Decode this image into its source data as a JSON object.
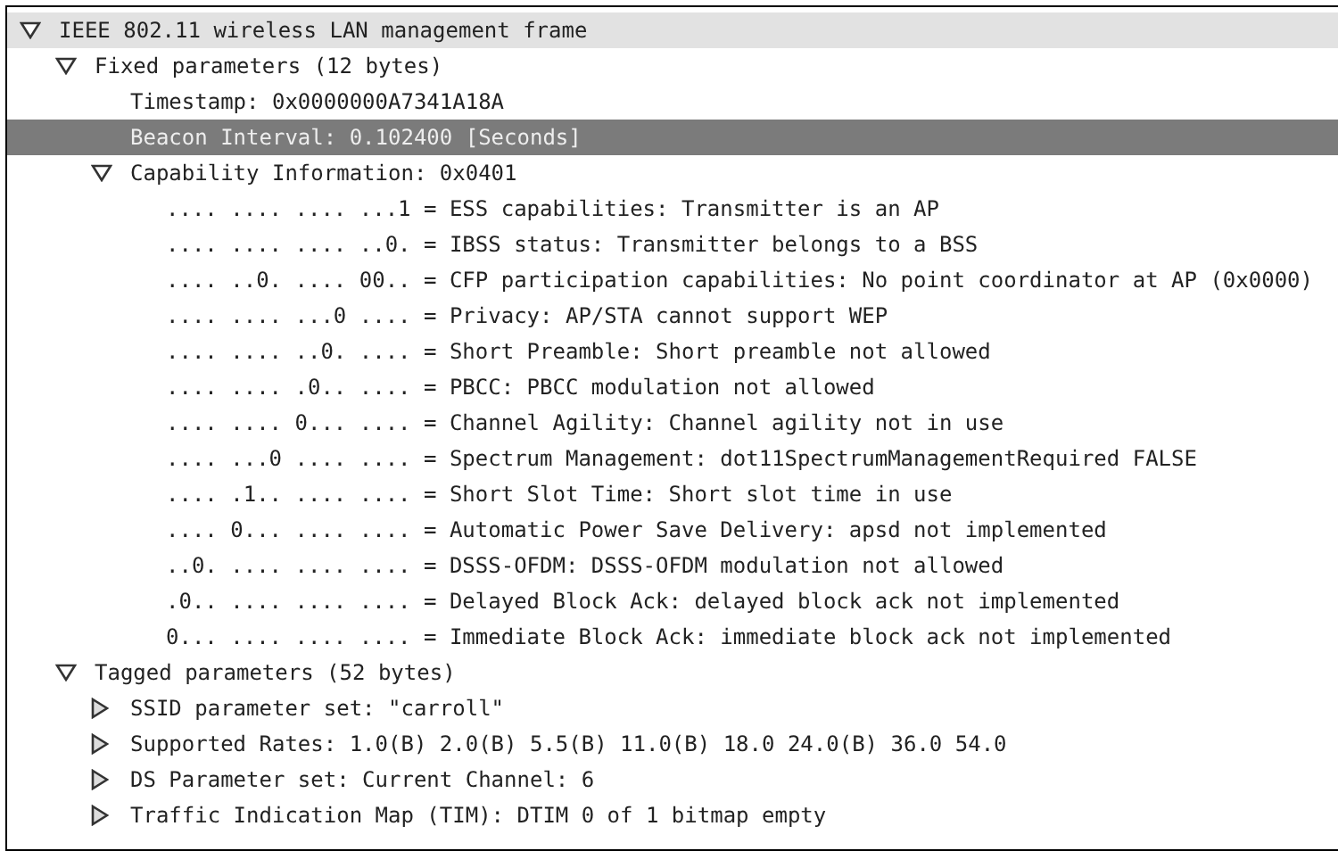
{
  "tree": [
    {
      "label": "IEEE 802.11 wireless LAN management frame",
      "expanded": true,
      "selected": false,
      "highlighted": true,
      "children": [
        {
          "label": "Fixed parameters (12 bytes)",
          "expanded": true,
          "selected": false,
          "highlighted": false,
          "children": [
            {
              "label": "Timestamp: 0x0000000A7341A18A",
              "selected": false,
              "highlighted": false
            },
            {
              "label": "Beacon Interval: 0.102400 [Seconds]",
              "selected": true,
              "highlighted": false
            },
            {
              "label": "Capability Information: 0x0401",
              "expanded": true,
              "selected": false,
              "highlighted": false,
              "children": [
                {
                  "label": ".... .... .... ...1 = ESS capabilities: Transmitter is an AP",
                  "selected": false,
                  "highlighted": false
                },
                {
                  "label": ".... .... .... ..0. = IBSS status: Transmitter belongs to a BSS",
                  "selected": false,
                  "highlighted": false
                },
                {
                  "label": ".... ..0. .... 00.. = CFP participation capabilities: No point coordinator at AP (0x0000)",
                  "selected": false,
                  "highlighted": false
                },
                {
                  "label": ".... .... ...0 .... = Privacy: AP/STA cannot support WEP",
                  "selected": false,
                  "highlighted": false
                },
                {
                  "label": ".... .... ..0. .... = Short Preamble: Short preamble not allowed",
                  "selected": false,
                  "highlighted": false
                },
                {
                  "label": ".... .... .0.. .... = PBCC: PBCC modulation not allowed",
                  "selected": false,
                  "highlighted": false
                },
                {
                  "label": ".... .... 0... .... = Channel Agility: Channel agility not in use",
                  "selected": false,
                  "highlighted": false
                },
                {
                  "label": ".... ...0 .... .... = Spectrum Management: dot11SpectrumManagementRequired FALSE",
                  "selected": false,
                  "highlighted": false
                },
                {
                  "label": ".... .1.. .... .... = Short Slot Time: Short slot time in use",
                  "selected": false,
                  "highlighted": false
                },
                {
                  "label": ".... 0... .... .... = Automatic Power Save Delivery: apsd not implemented",
                  "selected": false,
                  "highlighted": false
                },
                {
                  "label": "..0. .... .... .... = DSSS-OFDM: DSSS-OFDM modulation not allowed",
                  "selected": false,
                  "highlighted": false
                },
                {
                  "label": ".0.. .... .... .... = Delayed Block Ack: delayed block ack not implemented",
                  "selected": false,
                  "highlighted": false
                },
                {
                  "label": "0... .... .... .... = Immediate Block Ack: immediate block ack not implemented",
                  "selected": false,
                  "highlighted": false
                }
              ]
            }
          ]
        },
        {
          "label": "Tagged parameters (52 bytes)",
          "expanded": true,
          "selected": false,
          "highlighted": false,
          "children": [
            {
              "label": "SSID parameter set: \"carroll\"",
              "expanded": false,
              "selected": false,
              "highlighted": false
            },
            {
              "label": "Supported Rates: 1.0(B) 2.0(B) 5.5(B) 11.0(B) 18.0 24.0(B) 36.0 54.0",
              "expanded": false,
              "selected": false,
              "highlighted": false
            },
            {
              "label": "DS Parameter set: Current Channel: 6",
              "expanded": false,
              "selected": false,
              "highlighted": false
            },
            {
              "label": "Traffic Indication Map (TIM): DTIM 0 of 1 bitmap empty",
              "expanded": false,
              "selected": false,
              "highlighted": false
            }
          ]
        }
      ]
    }
  ]
}
